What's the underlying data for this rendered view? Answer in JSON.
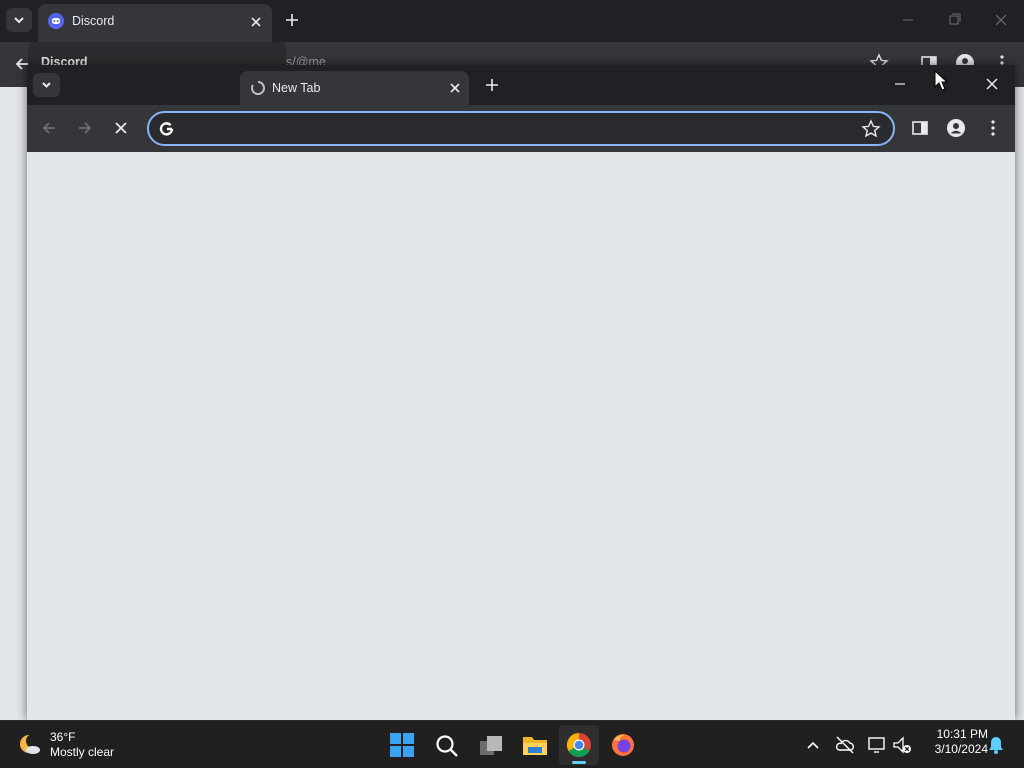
{
  "background_window": {
    "tab_title": "Discord",
    "popup_title": "Discord",
    "address_fragment": "s/@me"
  },
  "foreground_window": {
    "tab_title": "New Tab",
    "omnibox": {
      "value": "",
      "placeholder": ""
    }
  },
  "taskbar": {
    "weather": {
      "temp": "36°F",
      "condition": "Mostly clear"
    },
    "clock": {
      "time": "10:31 PM",
      "date": "3/10/2024"
    },
    "apps": [
      "start-icon",
      "search-icon",
      "task-view-icon",
      "file-explorer-icon",
      "chrome-icon",
      "firefox-icon"
    ]
  },
  "colors": {
    "accent": "#8ab4f8",
    "discord": "#5865f2",
    "taskbar": "#202020",
    "toolbar": "#35363a"
  }
}
